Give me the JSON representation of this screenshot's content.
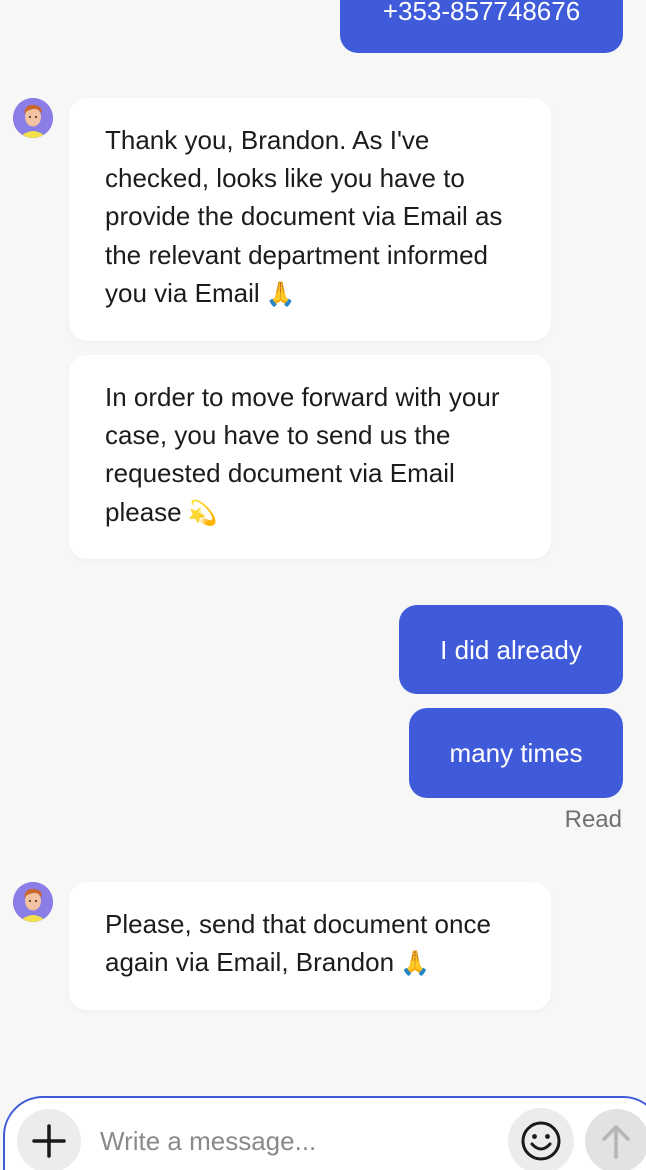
{
  "colors": {
    "accent": "#3f5bd9",
    "background": "#f7f7f8",
    "incoming_bubble": "#ffffff",
    "outgoing_text": "#ffffff"
  },
  "messages": {
    "outgoing_phone": "+353-857748676",
    "incoming_1": "Thank you, Brandon. As I've checked, looks like you have to provide the document via Email as the relevant department informed you via Email",
    "incoming_1_emoji": "🙏",
    "incoming_2": "In order to move forward with your case, you have to send us the requested document via Email please",
    "incoming_2_emoji": "💫",
    "outgoing_1": "I did already",
    "outgoing_2": "many times",
    "read_status": "Read",
    "incoming_3": "Please, send that document once again via Email, Brandon",
    "incoming_3_emoji": "🙏"
  },
  "composer": {
    "placeholder": "Write a message...",
    "icons": {
      "attach": "plus-icon",
      "emoji": "smiley-icon",
      "send": "arrow-up-icon"
    }
  }
}
